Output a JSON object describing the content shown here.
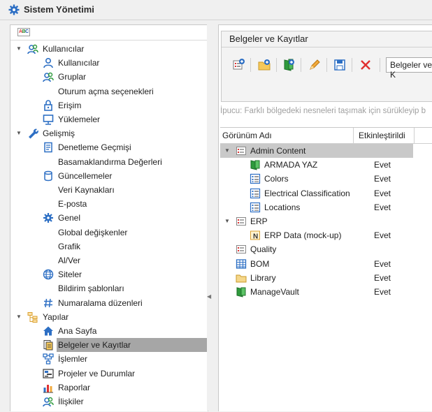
{
  "window": {
    "title": "Sistem Yönetimi"
  },
  "left_tree": {
    "filter_icon": "abc-filter-icon",
    "items": [
      {
        "label": "Kullanıcılar",
        "level": 0,
        "expanded": true,
        "icon": "users-icon"
      },
      {
        "label": "Kullanıcılar",
        "level": 1,
        "icon": "user-icon"
      },
      {
        "label": "Gruplar",
        "level": 1,
        "icon": "group-icon"
      },
      {
        "label": "Oturum açma seçenekleri",
        "level": 1,
        "icon": ""
      },
      {
        "label": "Erişim",
        "level": 1,
        "icon": "lock-icon"
      },
      {
        "label": "Yüklemeler",
        "level": 1,
        "icon": "monitor-icon"
      },
      {
        "label": "Gelişmiş",
        "level": 0,
        "expanded": true,
        "icon": "wrench-icon"
      },
      {
        "label": "Denetleme Geçmişi",
        "level": 1,
        "icon": "audit-icon"
      },
      {
        "label": "Basamaklandırma Değerleri",
        "level": 1,
        "icon": ""
      },
      {
        "label": "Güncellemeler",
        "level": 1,
        "icon": "database-icon"
      },
      {
        "label": "Veri Kaynakları",
        "level": 1,
        "icon": ""
      },
      {
        "label": "E-posta",
        "level": 1,
        "icon": ""
      },
      {
        "label": "Genel",
        "level": 1,
        "icon": "gear-icon"
      },
      {
        "label": "Global değişkenler",
        "level": 1,
        "icon": ""
      },
      {
        "label": "Grafik",
        "level": 1,
        "icon": ""
      },
      {
        "label": "Al/Ver",
        "level": 1,
        "icon": ""
      },
      {
        "label": "Siteler",
        "level": 1,
        "icon": "globe-icon"
      },
      {
        "label": "Bildirim şablonları",
        "level": 1,
        "icon": ""
      },
      {
        "label": "Numaralama düzenleri",
        "level": 1,
        "icon": "hash-icon"
      },
      {
        "label": "Yapılar",
        "level": 0,
        "expanded": true,
        "icon": "structure-icon"
      },
      {
        "label": "Ana Sayfa",
        "level": 1,
        "icon": "home-icon"
      },
      {
        "label": "Belgeler ve Kayıtlar",
        "level": 1,
        "icon": "documents-icon",
        "selected": true
      },
      {
        "label": "İşlemler",
        "level": 1,
        "icon": "workflow-icon"
      },
      {
        "label": "Projeler ve Durumlar",
        "level": 1,
        "icon": "projects-icon"
      },
      {
        "label": "Raporlar",
        "level": 1,
        "icon": "chart-icon"
      },
      {
        "label": "İlişkiler",
        "level": 1,
        "icon": "relations-icon"
      }
    ]
  },
  "right": {
    "group_title": "Belgeler ve Kayıtlar",
    "toolbar": {
      "icons": [
        "new-view-icon",
        "new-folder-icon",
        "add-item-icon",
        "edit-icon",
        "save-icon",
        "delete-icon"
      ],
      "combo_value": "Belgeler ve K"
    },
    "hint": "İpucu: Farklı bölgedeki nesneleri taşımak için sürükleyip b",
    "grid": {
      "col_name": "Görünüm Adı",
      "col_enabled": "Etkinleştirildi",
      "rows": [
        {
          "name": "Admin Content",
          "enabled": "",
          "level": 0,
          "expander": true,
          "icon": "folder-view-icon",
          "selected": true
        },
        {
          "name": "ARMADA YAZ",
          "enabled": "Evet",
          "level": 1,
          "icon": "vault-icon"
        },
        {
          "name": "Colors",
          "enabled": "Evet",
          "level": 1,
          "icon": "list-view-icon"
        },
        {
          "name": "Electrical Classification",
          "enabled": "Evet",
          "level": 1,
          "icon": "list-view-icon"
        },
        {
          "name": "Locations",
          "enabled": "Evet",
          "level": 1,
          "icon": "list-view-icon"
        },
        {
          "name": "ERP",
          "enabled": "",
          "level": 0,
          "expander": true,
          "icon": "folder-view-icon"
        },
        {
          "name": "ERP Data (mock-up)",
          "enabled": "Evet",
          "level": 1,
          "icon": "erp-icon"
        },
        {
          "name": "Quality",
          "enabled": "",
          "level": 0,
          "icon": "folder-view-icon"
        },
        {
          "name": "BOM",
          "enabled": "Evet",
          "level": 0,
          "icon": "table-icon"
        },
        {
          "name": "Library",
          "enabled": "Evet",
          "level": 0,
          "icon": "folder-icon"
        },
        {
          "name": "ManageVault",
          "enabled": "Evet",
          "level": 0,
          "icon": "vault-icon"
        }
      ]
    }
  },
  "colors": {
    "accent": "#2d6fc4",
    "selection": "#a6a6a6",
    "grid_selection": "#c9c9c9"
  }
}
